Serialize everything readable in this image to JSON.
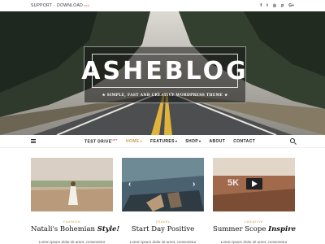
{
  "topbar": {
    "support": "SUPPORT",
    "separator": "·",
    "download": "DOWNLOAD",
    "download_badge": "PRO",
    "social_icons": [
      "facebook-icon",
      "twitter-icon",
      "instagram-icon",
      "pinterest-icon",
      "google-plus-icon"
    ],
    "social_glyphs": [
      "f",
      "t",
      "◎",
      "p",
      "G+"
    ]
  },
  "header": {
    "logo": "ASHEBLOG",
    "tagline": "★ SIMPLE, FAST AND CREATIVE WORDPRESS THEME ★"
  },
  "nav": {
    "items": [
      {
        "label": "TEST DRIVE",
        "badge": "HOT",
        "caret": ""
      },
      {
        "label": "HOME",
        "badge": "",
        "caret": "▾"
      },
      {
        "label": "FEATURES",
        "badge": "",
        "caret": "▾"
      },
      {
        "label": "SHOP",
        "badge": "",
        "caret": "▾"
      },
      {
        "label": "ABOUT",
        "badge": "",
        "caret": ""
      },
      {
        "label": "CONTACT",
        "badge": "",
        "caret": ""
      }
    ],
    "active_index": 1
  },
  "posts": [
    {
      "category": "FASHION",
      "title_plain": "Natali's Bohemian ",
      "title_em": "Style!",
      "excerpt": "Lorem ipsum dolor sit amet, consectetur"
    },
    {
      "category": "TRAVEL",
      "title_plain": "Start Day Positive",
      "title_em": "",
      "excerpt": "Lorem ipsum dolor sit amet, consectetur",
      "arrow_left": "‹",
      "arrow_right": "›"
    },
    {
      "category": "CREATIVE",
      "title_plain": "Summer Scope ",
      "title_em": "Inspire",
      "excerpt": "Lorem ipsum dolor sit amet, consectetur",
      "video_label": "5K"
    }
  ],
  "colors": {
    "accent": "#ca9b52",
    "badge_red": "#e04b4b"
  }
}
